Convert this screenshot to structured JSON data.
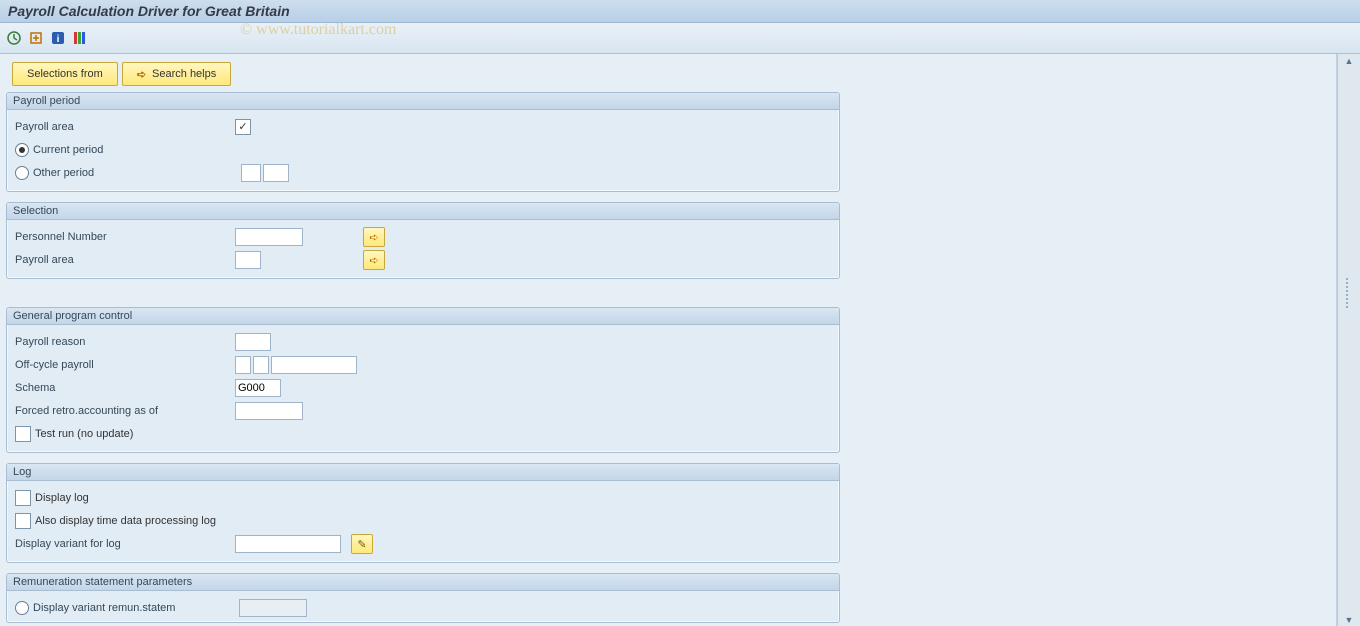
{
  "title": "Payroll Calculation Driver for Great Britain",
  "watermark": "© www.tutorialkart.com",
  "buttons": {
    "selections_from": "Selections from",
    "search_helps": "Search helps"
  },
  "groups": {
    "payroll_period": {
      "title": "Payroll period",
      "payroll_area_label": "Payroll area",
      "payroll_area_checked": "✓",
      "current_period": "Current period",
      "other_period": "Other period"
    },
    "selection": {
      "title": "Selection",
      "personnel_number": "Personnel Number",
      "payroll_area": "Payroll area"
    },
    "general": {
      "title": "General program control",
      "payroll_reason": "Payroll reason",
      "off_cycle": "Off-cycle payroll",
      "schema": "Schema",
      "schema_value": "G000",
      "forced_retro": "Forced retro.accounting as of",
      "test_run": "Test run (no update)"
    },
    "log": {
      "title": "Log",
      "display_log": "Display log",
      "also_display": "Also display time data processing log",
      "display_variant": "Display variant for log"
    },
    "remun": {
      "title": "Remuneration statement parameters",
      "display_variant_remun": "Display variant remun.statem"
    }
  },
  "icons": {
    "arrow_right": "➪",
    "pencil": "✎"
  }
}
